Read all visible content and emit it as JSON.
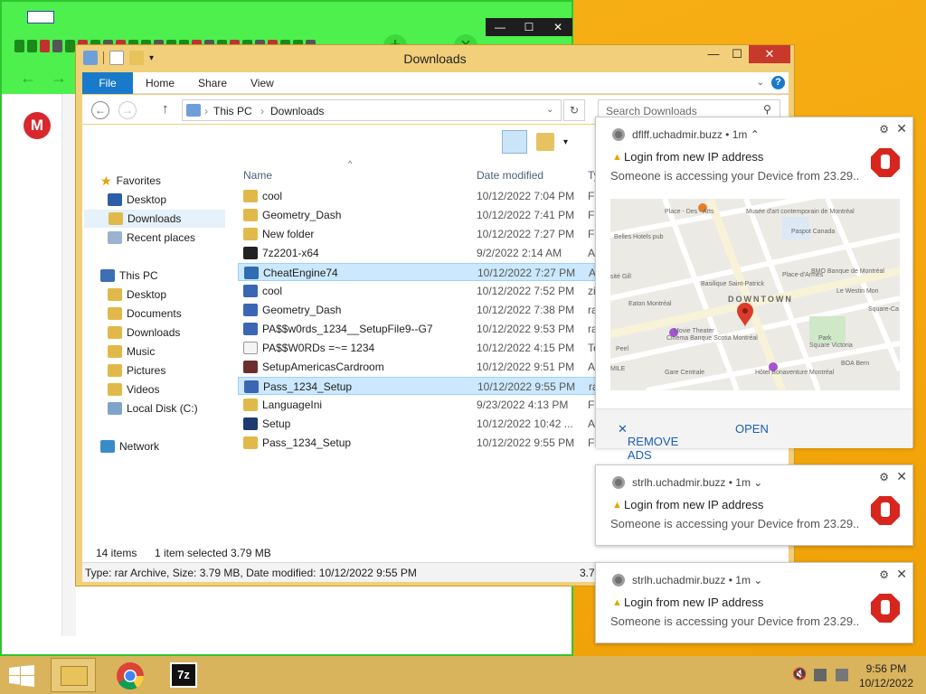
{
  "explorer": {
    "title": "Downloads",
    "ribbon_tabs": [
      "File",
      "Home",
      "Share",
      "View"
    ],
    "address": {
      "root": "This PC",
      "current": "Downloads"
    },
    "search_placeholder": "Search Downloads",
    "nav": {
      "favorites_header": "Favorites",
      "favorites": [
        "Desktop",
        "Downloads",
        "Recent places"
      ],
      "thispc_header": "This PC",
      "thispc": [
        "Desktop",
        "Documents",
        "Downloads",
        "Music",
        "Pictures",
        "Videos",
        "Local Disk (C:)"
      ],
      "network": "Network"
    },
    "columns": {
      "name": "Name",
      "date": "Date modified",
      "type": "Ty"
    },
    "files": [
      {
        "name": "cool",
        "date": "10/12/2022 7:04 PM",
        "type": "Fi",
        "icon": "folder-icon"
      },
      {
        "name": "Geometry_Dash",
        "date": "10/12/2022 7:41 PM",
        "type": "Fi",
        "icon": "folder-icon"
      },
      {
        "name": "New folder",
        "date": "10/12/2022 7:27 PM",
        "type": "Fi",
        "icon": "folder-icon"
      },
      {
        "name": "7z2201-x64",
        "date": "9/2/2022 2:14 AM",
        "type": "A",
        "icon": "7zip-icon"
      },
      {
        "name": "CheatEngine74",
        "date": "10/12/2022 7:27 PM",
        "type": "A",
        "icon": "cheatengine-icon"
      },
      {
        "name": "cool",
        "date": "10/12/2022 7:52 PM",
        "type": "zi",
        "icon": "zip-icon"
      },
      {
        "name": "Geometry_Dash",
        "date": "10/12/2022 7:38 PM",
        "type": "ra",
        "icon": "rar-icon"
      },
      {
        "name": "PA$$w0rds_1234__SetupFile9--G7",
        "date": "10/12/2022 9:53 PM",
        "type": "ra",
        "icon": "rar-icon"
      },
      {
        "name": "PA$$W0RDs =~= 1234",
        "date": "10/12/2022 4:15 PM",
        "type": "Te",
        "icon": "text-file-icon"
      },
      {
        "name": "SetupAmericasCardroom",
        "date": "10/12/2022 9:51 PM",
        "type": "A",
        "icon": "cardroom-icon"
      },
      {
        "name": "Pass_1234_Setup",
        "date": "10/12/2022 9:55 PM",
        "type": "ra",
        "icon": "rar-icon"
      },
      {
        "name": "LanguageIni",
        "date": "9/23/2022 4:13 PM",
        "type": "Fi",
        "icon": "folder-icon"
      },
      {
        "name": "Setup",
        "date": "10/12/2022 10:42 ...",
        "type": "A",
        "icon": "setup-icon"
      },
      {
        "name": "Pass_1234_Setup",
        "date": "10/12/2022 9:55 PM",
        "type": "Fi",
        "icon": "folder-icon"
      }
    ],
    "status": {
      "count": "14 items",
      "selected": "1 item selected  3.79 MB"
    },
    "details": {
      "text": "Type: rar Archive, Size: 3.79 MB, Date modified: 10/12/2022 9:55 PM",
      "size": "3.79"
    }
  },
  "notifications": [
    {
      "source": "dflff.uchadmir.buzz",
      "age": "1m",
      "title": "Login from new IP address",
      "body": "Someone is accessing your Device from 23.29..",
      "map_labels": [
        "Place - Des - Arts",
        "Musée d'art contemporain de Montréal",
        "Paspot Canada",
        "Belles Hotels pub",
        "BMO Banque de Montréal",
        "Basilique Saint-Patrick",
        "Place-d'Armes",
        "DOWNTOWN",
        "Le Westin Mon",
        "Eaton Montréal",
        "Movie Theater",
        "Cinema Banque Scotia Montréal",
        "Gare Centrale",
        "Hôtel Bonaventure Montréal",
        "BOA Bern",
        "Park",
        "Square Victoria",
        "Square-Ca",
        "Peel",
        "MILE",
        "sité Gill"
      ],
      "actions": {
        "remove": "REMOVE ADS",
        "open": "OPEN"
      }
    },
    {
      "source": "strlh.uchadmir.buzz",
      "age": "1m",
      "title": "Login from new IP address",
      "body": "Someone is accessing your Device from 23.29.."
    },
    {
      "source": "strlh.uchadmir.buzz",
      "age": "1m",
      "title": "Login from new IP address",
      "body": "Someone is accessing your Device from 23.29.."
    }
  ],
  "taskbar": {
    "time": "9:56 PM",
    "date": "10/12/2022"
  },
  "colors": {
    "selection": "#cce8ff",
    "accent": "#1979ca",
    "stop_red": "#d7261e",
    "taskbar": "#d9b45c"
  }
}
